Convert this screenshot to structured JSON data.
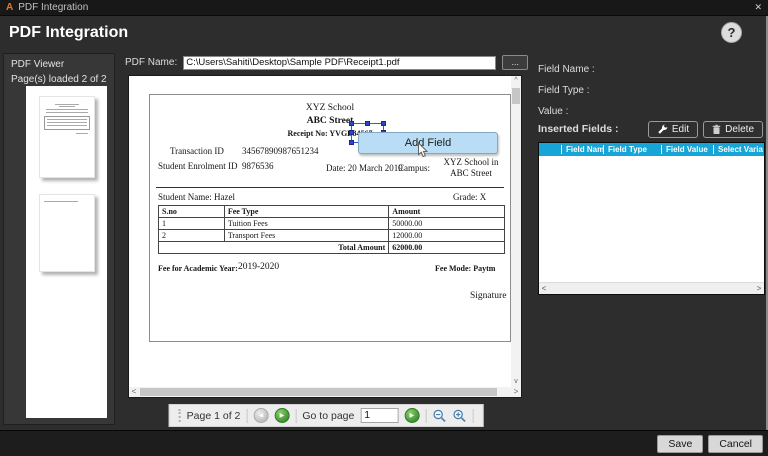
{
  "titlebar": {
    "title": "PDF Integration"
  },
  "header": {
    "title": "PDF Integration",
    "help": "?"
  },
  "sidebar": {
    "title": "PDF Viewer",
    "status": "Page(s) loaded 2 of 2"
  },
  "pdf_name": {
    "label": "PDF Name:",
    "value": "C:\\Users\\Sahiti\\Desktop\\Sample PDF\\Receipt1.pdf",
    "browse": "..."
  },
  "document": {
    "school": "XYZ School",
    "street": "ABC Street",
    "receipt_line": "Receipt No: YVGB34567",
    "transaction_id_label": "Transaction ID",
    "transaction_id_value": "34567890987651234",
    "enrolment_label": "Student Enrolment ID",
    "enrolment_value": "9876536",
    "date": "Date: 20 March 2019",
    "campus_label": "Campus:",
    "campus_value": "XYZ School in ABC Street",
    "student_name": "Student Name:  Hazel",
    "grade": "Grade: X",
    "fee_table": {
      "headers": [
        "S.no",
        "Fee Type",
        "Amount"
      ],
      "rows": [
        [
          "1",
          "Tuition Fees",
          "50000.00"
        ],
        [
          "2",
          "Transport Fees",
          "12000.00"
        ]
      ],
      "total_label": "Total Amount",
      "total_value": "62000.00"
    },
    "academic_year_label": "Fee for Academic Year:",
    "academic_year_value": "2019-2020",
    "fee_mode": "Fee Mode: Paytm",
    "signature": "Signature"
  },
  "add_field_popup": {
    "label": "Add Field"
  },
  "fields_panel": {
    "field_name_label": "Field Name :",
    "field_type_label": "Field Type :",
    "value_label": "Value :",
    "inserted_fields_label": "Inserted Fields :",
    "edit": "Edit",
    "delete": "Delete",
    "columns": [
      "",
      "Field Name",
      "Field Type",
      "Field Value",
      "Select Varia"
    ]
  },
  "pagination": {
    "page_status": "Page 1 of 2",
    "goto_label": "Go to page",
    "goto_value": "1"
  },
  "footer": {
    "save": "Save",
    "cancel": "Cancel"
  },
  "icons": {
    "logo": "A",
    "close": "✕",
    "prev_arrow": "◀",
    "next_arrow": "▶",
    "go_arrow": "▶",
    "scroll_up": "^",
    "scroll_down": "v",
    "scroll_left": "<",
    "scroll_right": ">"
  },
  "colors": {
    "accent_cyan": "#16a5d6",
    "nav_green": "#3a9130",
    "popup_blue": "#b9ddf4",
    "handle_blue": "#2946c8",
    "logo_orange": "#e87722"
  }
}
